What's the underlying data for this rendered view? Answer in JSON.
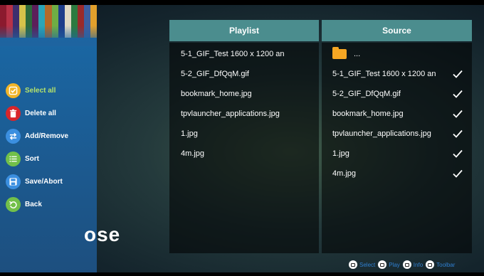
{
  "sidebar": {
    "stripe_colors": [
      "#8b1a2e",
      "#b83247",
      "#3d2f6e",
      "#d7c34a",
      "#2e6b3b",
      "#5c1f5a",
      "#2aa5b8",
      "#b56a28",
      "#6fae44",
      "#1e3d8a",
      "#e1d9c4",
      "#2c7a3f",
      "#9a2a2a",
      "#3d5fa0",
      "#e2a02c"
    ],
    "items": [
      {
        "label": "Select all",
        "icon": "check-icon",
        "color": "#f0b429",
        "active": true
      },
      {
        "label": "Delete all",
        "icon": "trash-icon",
        "color": "#d8262b",
        "active": false
      },
      {
        "label": "Add/Remove",
        "icon": "swap-arrows-icon",
        "color": "#3b8fe0",
        "active": false
      },
      {
        "label": "Sort",
        "icon": "list-icon",
        "color": "#72c04a",
        "active": false
      },
      {
        "label": "Save/Abort",
        "icon": "save-icon",
        "color": "#3b8fe0",
        "active": false
      },
      {
        "label": "Back",
        "icon": "back-icon",
        "color": "#72c04a",
        "active": false
      }
    ]
  },
  "background_title": "ose",
  "playlist": {
    "header": "Playlist",
    "items": [
      "5-1_GIF_Test 1600 x 1200 an",
      "5-2_GIF_DfQqM.gif",
      "bookmark_home.jpg",
      "tpvlauncher_applications.jpg",
      "1.jpg",
      "4m.jpg"
    ]
  },
  "source": {
    "header": "Source",
    "folder_label": "...",
    "items": [
      "5-1_GIF_Test 1600 x 1200 an",
      "5-2_GIF_DfQqM.gif",
      "bookmark_home.jpg",
      "tpvlauncher_applications.jpg",
      "1.jpg",
      "4m.jpg"
    ]
  },
  "hints": [
    {
      "label": "Select",
      "icon": "select-key-icon"
    },
    {
      "label": "Play",
      "icon": "play-key-icon"
    },
    {
      "label": "Info",
      "icon": "info-key-icon"
    },
    {
      "label": "Toolbar",
      "icon": "toolbar-key-icon"
    }
  ]
}
